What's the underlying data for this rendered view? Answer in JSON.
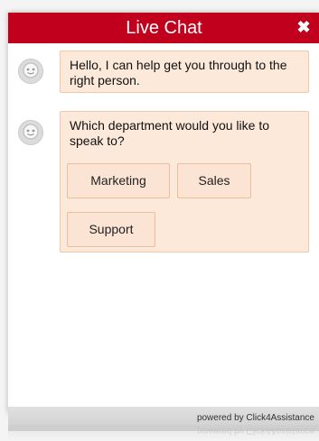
{
  "header": {
    "title": "Live Chat",
    "close_icon": "close-icon",
    "color": "#c0001c"
  },
  "messages": [
    {
      "avatar_icon": "agent-avatar-icon",
      "text": "Hello, I can help get you through to the right person."
    },
    {
      "avatar_icon": "agent-avatar-icon",
      "text": "Which department would you like to speak to?"
    }
  ],
  "options": [
    {
      "label": "Marketing"
    },
    {
      "label": "Sales"
    },
    {
      "label": "Support"
    }
  ],
  "footer": {
    "text": "powered by Click4Assistance"
  }
}
